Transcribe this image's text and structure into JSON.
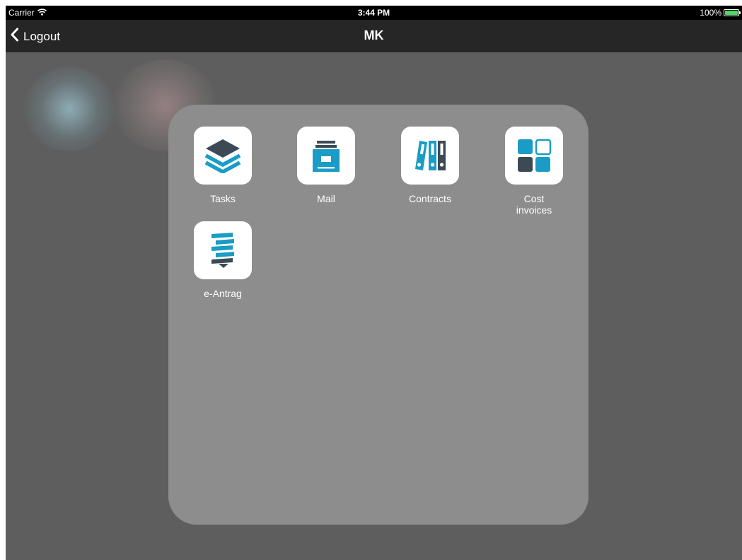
{
  "status_bar": {
    "carrier": "Carrier",
    "time": "3:44 PM",
    "battery": "100%",
    "battery_level": 1.0,
    "icons": [
      "wifi-icon",
      "battery-icon"
    ]
  },
  "nav": {
    "back_label": "Logout",
    "back_icon": "chevron-left-icon",
    "title": "MK"
  },
  "apps": [
    {
      "label": "Tasks",
      "icon": "layers-icon"
    },
    {
      "label": "Mail",
      "icon": "file-cabinet-icon"
    },
    {
      "label": "Contracts",
      "icon": "binders-icon"
    },
    {
      "label": "Cost\ninvoices",
      "icon": "tiles-icon"
    },
    {
      "label": "e-Antrag",
      "icon": "stacked-forms-icon"
    }
  ],
  "colors": {
    "accent": "#1a9cc6",
    "icon_dark": "#3d4a55",
    "battery": "#4cd964"
  }
}
